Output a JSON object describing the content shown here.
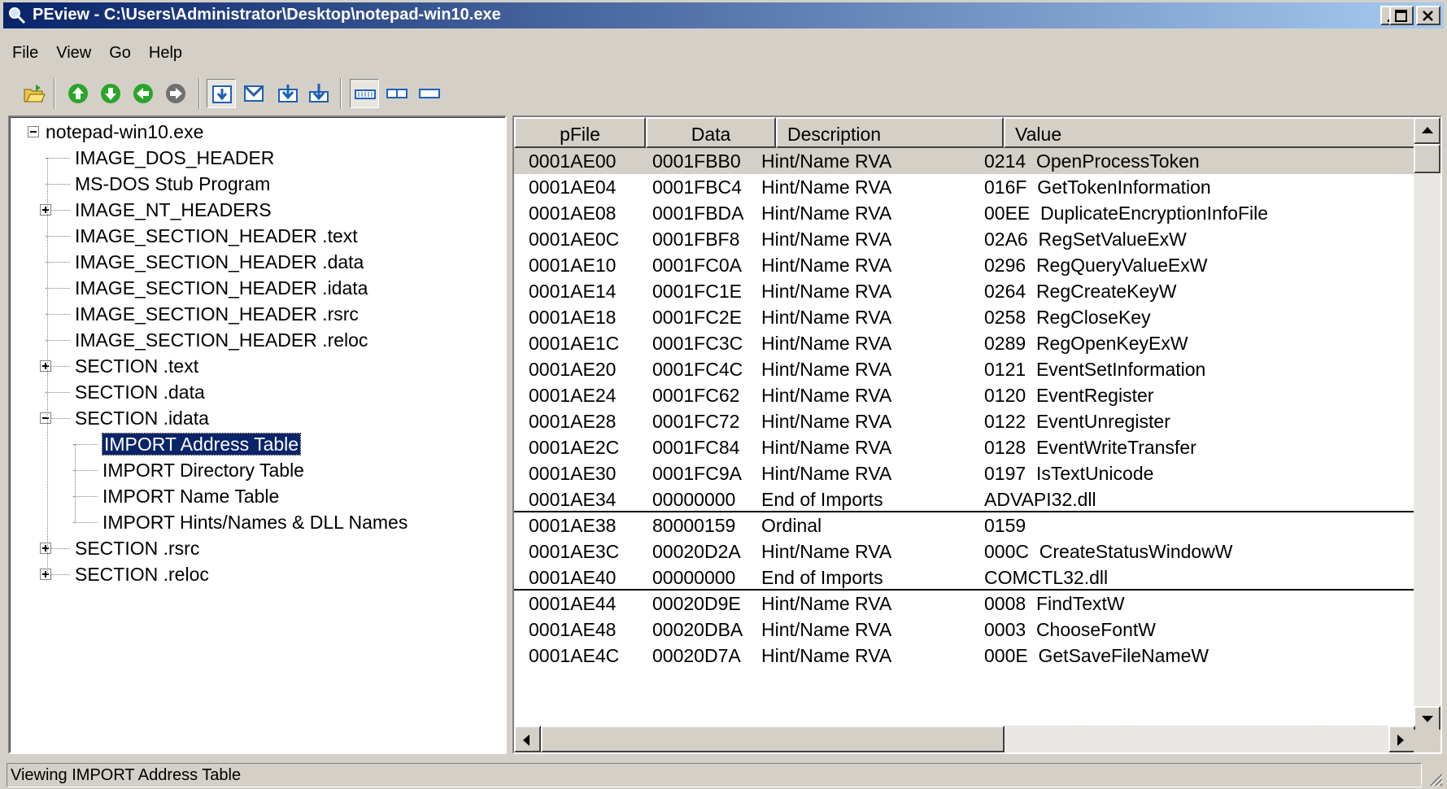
{
  "window": {
    "title": "PEview - C:\\Users\\Administrator\\Desktop\\notepad-win10.exe"
  },
  "menu": [
    "File",
    "View",
    "Go",
    "Help"
  ],
  "toolbar": {
    "buttons": [
      "open-icon",
      "forward-icon",
      "down-icon",
      "back-icon",
      "next-disabled-icon",
      "view-byte-icon",
      "view-word-icon",
      "view-dword-icon",
      "view-qword-icon",
      "view-hex-icon",
      "view-mid-icon",
      "view-min-icon"
    ]
  },
  "tree": {
    "items": [
      {
        "label": "notepad-win10.exe",
        "level": 0,
        "toggle": "minus"
      },
      {
        "label": "IMAGE_DOS_HEADER",
        "level": 1
      },
      {
        "label": "MS-DOS Stub Program",
        "level": 1
      },
      {
        "label": "IMAGE_NT_HEADERS",
        "level": 1,
        "toggle": "plus"
      },
      {
        "label": "IMAGE_SECTION_HEADER .text",
        "level": 1
      },
      {
        "label": "IMAGE_SECTION_HEADER .data",
        "level": 1
      },
      {
        "label": "IMAGE_SECTION_HEADER .idata",
        "level": 1
      },
      {
        "label": "IMAGE_SECTION_HEADER .rsrc",
        "level": 1
      },
      {
        "label": "IMAGE_SECTION_HEADER .reloc",
        "level": 1
      },
      {
        "label": "SECTION .text",
        "level": 1,
        "toggle": "plus"
      },
      {
        "label": "SECTION .data",
        "level": 1
      },
      {
        "label": "SECTION .idata",
        "level": 1,
        "toggle": "minus"
      },
      {
        "label": "IMPORT Address Table",
        "level": 2,
        "selected": true
      },
      {
        "label": "IMPORT Directory Table",
        "level": 2
      },
      {
        "label": "IMPORT Name Table",
        "level": 2
      },
      {
        "label": "IMPORT Hints/Names & DLL Names",
        "level": 2
      },
      {
        "label": "SECTION .rsrc",
        "level": 1,
        "toggle": "plus"
      },
      {
        "label": "SECTION .reloc",
        "level": 1,
        "toggle": "plus"
      }
    ]
  },
  "list": {
    "columns": [
      "pFile",
      "Data",
      "Description",
      "Value"
    ],
    "rows": [
      {
        "pfile": "0001AE00",
        "data": "0001FBB0",
        "desc": "Hint/Name RVA",
        "value": "0214  OpenProcessToken"
      },
      {
        "pfile": "0001AE04",
        "data": "0001FBC4",
        "desc": "Hint/Name RVA",
        "value": "016F  GetTokenInformation"
      },
      {
        "pfile": "0001AE08",
        "data": "0001FBDA",
        "desc": "Hint/Name RVA",
        "value": "00EE  DuplicateEncryptionInfoFile"
      },
      {
        "pfile": "0001AE0C",
        "data": "0001FBF8",
        "desc": "Hint/Name RVA",
        "value": "02A6  RegSetValueExW"
      },
      {
        "pfile": "0001AE10",
        "data": "0001FC0A",
        "desc": "Hint/Name RVA",
        "value": "0296  RegQueryValueExW"
      },
      {
        "pfile": "0001AE14",
        "data": "0001FC1E",
        "desc": "Hint/Name RVA",
        "value": "0264  RegCreateKeyW"
      },
      {
        "pfile": "0001AE18",
        "data": "0001FC2E",
        "desc": "Hint/Name RVA",
        "value": "0258  RegCloseKey"
      },
      {
        "pfile": "0001AE1C",
        "data": "0001FC3C",
        "desc": "Hint/Name RVA",
        "value": "0289  RegOpenKeyExW"
      },
      {
        "pfile": "0001AE20",
        "data": "0001FC4C",
        "desc": "Hint/Name RVA",
        "value": "0121  EventSetInformation"
      },
      {
        "pfile": "0001AE24",
        "data": "0001FC62",
        "desc": "Hint/Name RVA",
        "value": "0120  EventRegister"
      },
      {
        "pfile": "0001AE28",
        "data": "0001FC72",
        "desc": "Hint/Name RVA",
        "value": "0122  EventUnregister"
      },
      {
        "pfile": "0001AE2C",
        "data": "0001FC84",
        "desc": "Hint/Name RVA",
        "value": "0128  EventWriteTransfer"
      },
      {
        "pfile": "0001AE30",
        "data": "0001FC9A",
        "desc": "Hint/Name RVA",
        "value": "0197  IsTextUnicode"
      },
      {
        "pfile": "0001AE34",
        "data": "00000000",
        "desc": "End of Imports",
        "value": "ADVAPI32.dll",
        "sep": true
      },
      {
        "pfile": "0001AE38",
        "data": "80000159",
        "desc": "Ordinal",
        "value": "0159"
      },
      {
        "pfile": "0001AE3C",
        "data": "00020D2A",
        "desc": "Hint/Name RVA",
        "value": "000C  CreateStatusWindowW"
      },
      {
        "pfile": "0001AE40",
        "data": "00000000",
        "desc": "End of Imports",
        "value": "COMCTL32.dll",
        "sep": true
      },
      {
        "pfile": "0001AE44",
        "data": "00020D9E",
        "desc": "Hint/Name RVA",
        "value": "0008  FindTextW"
      },
      {
        "pfile": "0001AE48",
        "data": "00020DBA",
        "desc": "Hint/Name RVA",
        "value": "0003  ChooseFontW"
      },
      {
        "pfile": "0001AE4C",
        "data": "00020D7A",
        "desc": "Hint/Name RVA",
        "value": "000E  GetSaveFileNameW"
      }
    ]
  },
  "status": {
    "text": "Viewing IMPORT Address Table"
  }
}
